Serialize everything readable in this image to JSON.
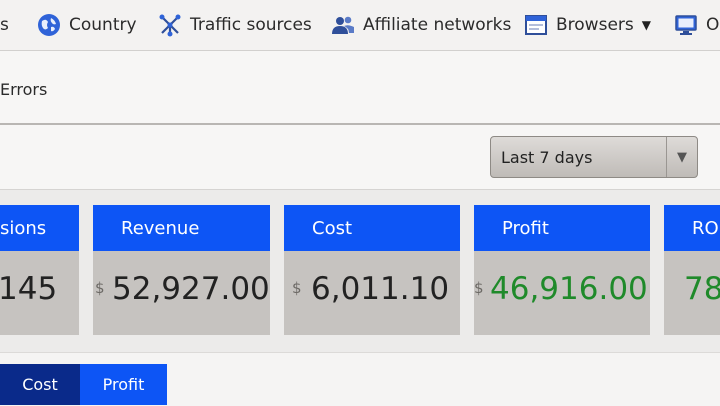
{
  "nav": {
    "partial_first": "s",
    "items": [
      {
        "label": "Country",
        "icon": "globe-icon"
      },
      {
        "label": "Traffic sources",
        "icon": "traffic-sources-icon"
      },
      {
        "label": "Affiliate networks",
        "icon": "users-icon"
      },
      {
        "label": "Browsers",
        "icon": "browser-window-icon"
      },
      {
        "label": "O:",
        "icon": "monitor-icon"
      }
    ]
  },
  "subnav": {
    "errors_label": "Errors"
  },
  "controls": {
    "date_range": "Last 7 days"
  },
  "metrics": [
    {
      "title": "sions",
      "value": "145",
      "currency": ""
    },
    {
      "title": "Revenue",
      "value": "52,927.00",
      "currency": "$"
    },
    {
      "title": "Cost",
      "value": "6,011.10",
      "currency": "$"
    },
    {
      "title": "Profit",
      "value": "46,916.00",
      "currency": "$"
    },
    {
      "title": "RO",
      "value": "78",
      "currency": ""
    }
  ],
  "tabs": [
    {
      "label": "Cost",
      "color": "#0a2a8a"
    },
    {
      "label": "Profit",
      "color": "#0d55f5"
    }
  ],
  "colors": {
    "accent": "#0d55f5",
    "positive": "#1f8a2a"
  }
}
